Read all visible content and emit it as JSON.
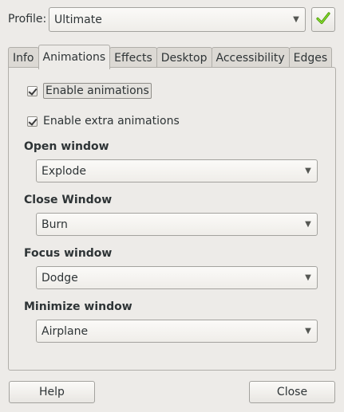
{
  "profile": {
    "label": "Profile:",
    "value": "Ultimate",
    "apply_icon": "check-icon"
  },
  "tabs": [
    {
      "label": "Info"
    },
    {
      "label": "Animations",
      "active": true
    },
    {
      "label": "Effects"
    },
    {
      "label": "Desktop"
    },
    {
      "label": "Accessibility"
    },
    {
      "label": "Edges"
    }
  ],
  "animations": {
    "enable_animations": {
      "label": "Enable animations",
      "checked": true
    },
    "enable_extra": {
      "label": "Enable extra animations",
      "checked": true
    },
    "open_window": {
      "title": "Open window",
      "value": "Explode"
    },
    "close_window": {
      "title": "Close Window",
      "value": "Burn"
    },
    "focus_window": {
      "title": "Focus window",
      "value": "Dodge"
    },
    "minimize_window": {
      "title": "Minimize window",
      "value": "Airplane"
    }
  },
  "buttons": {
    "help": "Help",
    "close": "Close"
  },
  "colors": {
    "check_green": "#5aa526"
  }
}
